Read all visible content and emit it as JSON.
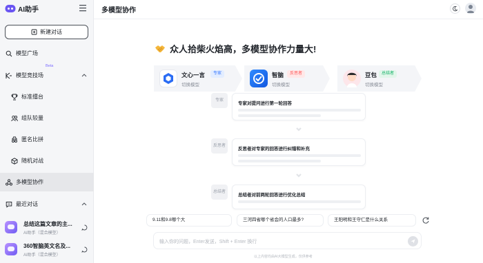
{
  "app": {
    "name": "AI助手"
  },
  "sidebar": {
    "new_chat": "新建对话",
    "items": [
      {
        "label": "模型广场",
        "icon": "search-icon"
      },
      {
        "label": "模型竞技场",
        "icon": "arena-icon",
        "badge": "Beta"
      },
      {
        "label": "标准擂台",
        "icon": "trophy-icon"
      },
      {
        "label": "组队较量",
        "icon": "team-icon"
      },
      {
        "label": "匿名比拼",
        "icon": "anonymous-icon"
      },
      {
        "label": "随机对战",
        "icon": "dice-icon"
      },
      {
        "label": "多模型协作",
        "icon": "collab-icon"
      },
      {
        "label": "最近对话",
        "icon": "history-icon"
      }
    ],
    "history": [
      {
        "title": "总结这篇文章的主...",
        "sub": "AI助手（混合模型）"
      },
      {
        "title": "360智脑英文名及...",
        "sub": "AI助手（混合模型）"
      }
    ]
  },
  "header": {
    "title": "多模型协作"
  },
  "main": {
    "headline": "众人拾柴火焰高，多模型协作力量大!",
    "models": [
      {
        "name": "文心一言",
        "tag": "专家",
        "switch": "切换模型",
        "tag_color": "#3b7bff"
      },
      {
        "name": "智脑",
        "tag": "反思者",
        "switch": "切换模型",
        "tag_color": "#ff5a5a"
      },
      {
        "name": "豆包",
        "tag": "总结者",
        "switch": "切换模型",
        "tag_color": "#19b36b"
      }
    ],
    "flow": [
      {
        "role": "专家",
        "text": "专家对提问进行第一轮回答"
      },
      {
        "role": "反思者",
        "text": "反思者对专家的回答进行纠错和补充"
      },
      {
        "role": "总结者",
        "text": "总结者对前两轮回答进行优化总结"
      }
    ],
    "suggestions": [
      "9.11和9.8哪个大",
      "三河四省哪个省会的人口最多?",
      "王阳明和王守仁是什么关系"
    ],
    "input_placeholder": "输入你的问题，Enter发送，Shift + Enter 换行",
    "footer": "以上内容均由AI大模型生成，仅供参考"
  }
}
